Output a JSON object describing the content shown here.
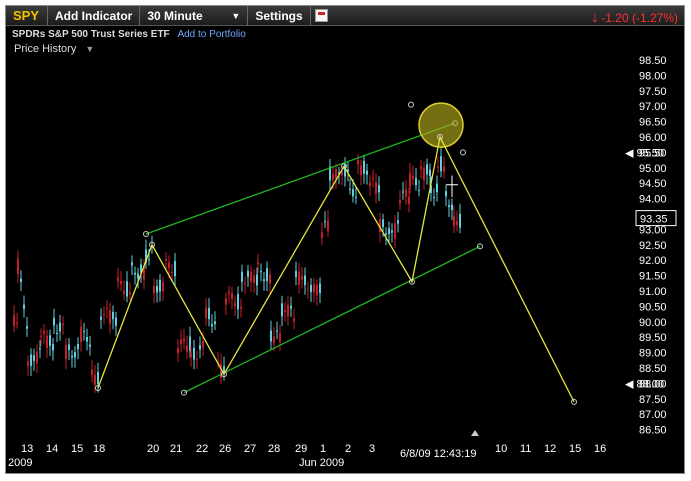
{
  "toolbar": {
    "symbol": "SPY",
    "add_indicator": "Add Indicator",
    "interval": "30 Minute",
    "settings": "Settings",
    "change": "-1.20 (-1.27%)"
  },
  "header": {
    "description": "SPDRs S&P 500 Trust Series ETF",
    "add_to_portfolio": "Add to Portfolio",
    "panel_title": "Price History"
  },
  "colors": {
    "up": "#5fd0e0",
    "down": "#c81e28",
    "channel": "#22b422",
    "swing": "#e6e63c",
    "highlight": "#b4aa1e",
    "change": "#ff3030",
    "symbol": "#f5c000"
  },
  "chart_data": {
    "type": "candlestick",
    "y_ticks": [
      "98.50",
      "98.00",
      "97.50",
      "97.00",
      "96.50",
      "96.00",
      "95.50",
      "95.00",
      "94.50",
      "94.00",
      "93.50",
      "93.00",
      "92.50",
      "92.00",
      "91.50",
      "91.00",
      "90.50",
      "90.00",
      "89.50",
      "89.00",
      "88.50",
      "88.00",
      "87.50",
      "87.00",
      "86.50"
    ],
    "x_ticks": [
      "13",
      "14",
      "15",
      "18",
      "20",
      "21",
      "22",
      "26",
      "27",
      "28",
      "29",
      "1",
      "2",
      "3",
      "10",
      "11",
      "12",
      "15",
      "16"
    ],
    "x_period_labels": [
      "2009",
      "Jun 2009"
    ],
    "last_price": "93.35",
    "price_marker_1": "95.50",
    "price_marker_2": "88.00",
    "cursor_timestamp": "6/8/09 12:43:19",
    "ylim": [
      86.5,
      98.5
    ],
    "swing_path": [
      {
        "x": "18",
        "y": 87.85
      },
      {
        "x": "20",
        "y": 92.5
      },
      {
        "x": "26",
        "y": 88.3
      },
      {
        "x": "2",
        "y": 95.05
      },
      {
        "x": "8",
        "y": 91.3
      },
      {
        "x": "9",
        "y": 96.0
      },
      {
        "x": "15",
        "y": 87.4
      }
    ],
    "channel_upper": [
      {
        "x": "20",
        "y": 92.85
      },
      {
        "x": "9",
        "y": 96.45
      }
    ],
    "channel_lower": [
      {
        "x": "22",
        "y": 87.7
      },
      {
        "x": "9",
        "y": 92.45
      }
    ],
    "highlight_point": {
      "x": "9",
      "y": 96.45
    },
    "extra_points": [
      {
        "x": "8",
        "y": 97.05
      },
      {
        "x": "9",
        "y": 95.5
      }
    ]
  }
}
